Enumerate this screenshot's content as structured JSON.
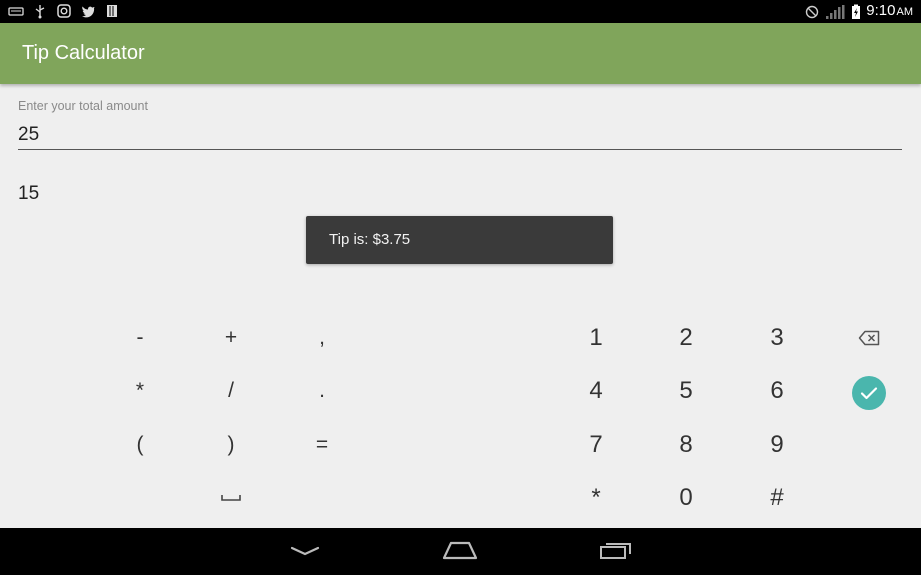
{
  "status_bar": {
    "time": "9:10",
    "ampm": "AM",
    "left_icons": [
      "keyboard-icon",
      "usb-icon",
      "instagram-icon",
      "twitter-icon",
      "storage-icon"
    ],
    "right_icons": [
      "no-sim-icon",
      "signal-icon",
      "battery-charging-icon"
    ]
  },
  "app_bar": {
    "title": "Tip Calculator",
    "color": "#80a55b"
  },
  "form": {
    "amount_label": "Enter your total amount",
    "amount_value": "25",
    "percent_value": "15"
  },
  "toast": {
    "text": "Tip is: $3.75"
  },
  "keyboard": {
    "symbols": [
      "-",
      "+",
      ",",
      "*",
      "/",
      ".",
      "(",
      ")",
      "="
    ],
    "space_icon": "space-icon",
    "digits": [
      "1",
      "2",
      "3",
      "4",
      "5",
      "6",
      "7",
      "8",
      "9",
      "*",
      "0",
      "#"
    ],
    "backspace_icon": "backspace-icon",
    "done_icon": "check-icon",
    "done_color": "#4ab6ad"
  },
  "nav_bar": {
    "icons": [
      "back-icon",
      "home-icon",
      "recents-icon"
    ]
  }
}
